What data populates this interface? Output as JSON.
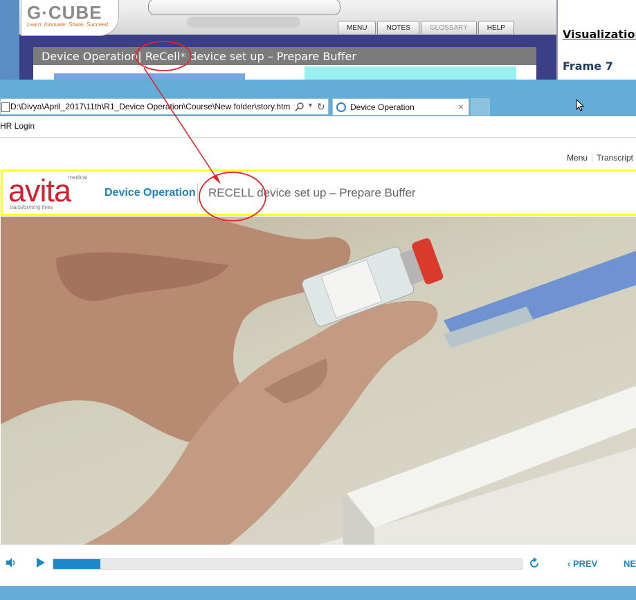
{
  "storyboard": {
    "logo_text": "G·CUBE",
    "logo_tagline": "Learn. Innovate. Share. Succeed.",
    "menu": [
      "MENU",
      "NOTES",
      "GLOSSARY",
      "HELP"
    ],
    "slide_title_prefix": "Device Operation| ",
    "slide_title_brand": "ReCell",
    "slide_title_reg": "®",
    "slide_title_suffix": " device set up – Prepare Buffer",
    "doc_heading": "Visualization",
    "doc_frame": "Frame 7"
  },
  "browser": {
    "url": "D:\\Divya\\April_2017\\11th\\R1_Device Operation\\Course\\New folder\\story.htm",
    "tab_title": "Device Operation",
    "favorites": "HR Login"
  },
  "course": {
    "top_links": {
      "menu": "Menu",
      "transcript": "Transcript"
    },
    "logo_word": "avita",
    "logo_superscript": "medical",
    "logo_tagline": "transforming lives",
    "course_name": "Device Operation",
    "slide_title": "RECELL device set up – Prepare Buffer"
  },
  "player": {
    "progress": 0.1,
    "prev_label": "PREV",
    "next_label": "NE"
  },
  "colors": {
    "accent_blue": "#1b88c8",
    "annotation_red": "#e0262a",
    "header_highlight": "#ffff2e",
    "brand_red": "#d2202d"
  },
  "icons": [
    "search-icon",
    "dropdown-icon",
    "refresh-icon",
    "close-icon",
    "ie-icon",
    "mute-icon",
    "play-icon",
    "replay-icon",
    "chevron-left-icon",
    "cursor-icon"
  ]
}
